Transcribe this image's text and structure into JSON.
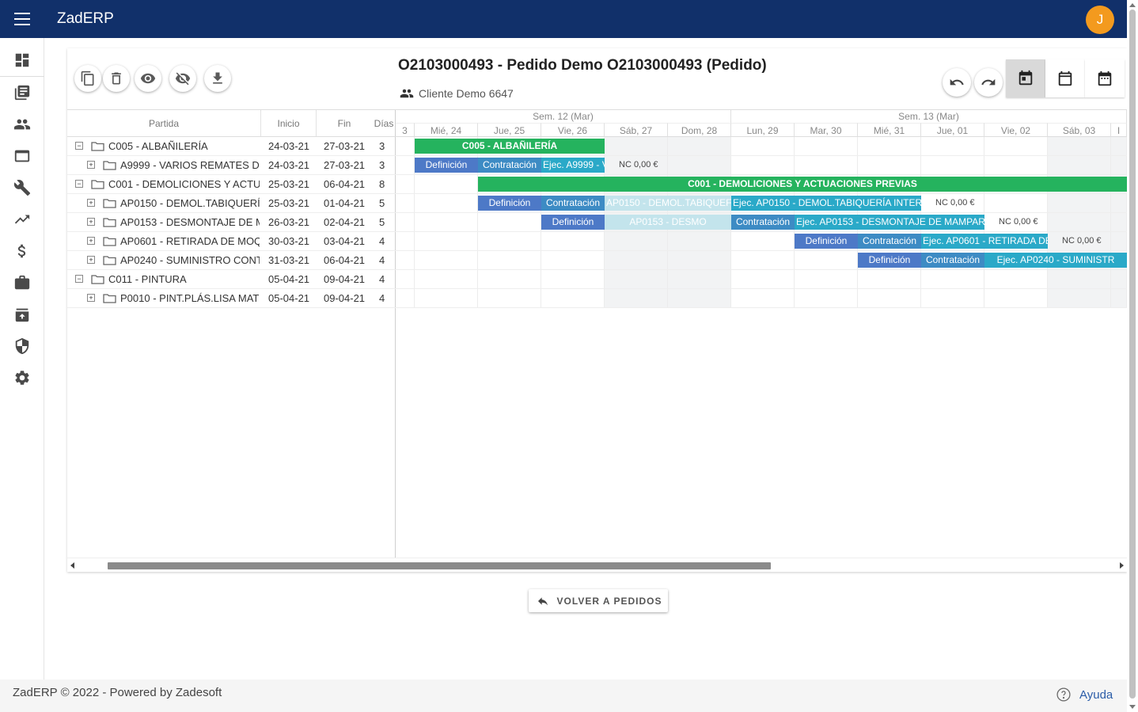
{
  "app": {
    "title": "ZadERP",
    "avatar_letter": "J"
  },
  "sidebar": {
    "items": [
      "dashboard-icon",
      "library-icon",
      "people-icon",
      "browser-icon",
      "wrench-icon",
      "trending-icon",
      "dollar-icon",
      "briefcase-icon",
      "archive-icon",
      "shield-icon",
      "gear-icon"
    ]
  },
  "document": {
    "title": "O2103000493 - Pedido Demo O2103000493 (Pedido)",
    "client": "Cliente Demo 6647"
  },
  "table": {
    "headers": {
      "partida": "Partida",
      "inicio": "Inicio",
      "fin": "Fin",
      "dias": "Días"
    },
    "rows": [
      {
        "level": 0,
        "exp": "−",
        "name": "C005 - ALBAÑILERÍA",
        "inicio": "24-03-21",
        "fin": "27-03-21",
        "dias": "3"
      },
      {
        "level": 1,
        "exp": "+",
        "name": "A9999 - VARIOS REMATES DI",
        "inicio": "24-03-21",
        "fin": "27-03-21",
        "dias": "3"
      },
      {
        "level": 0,
        "exp": "−",
        "name": "C001 - DEMOLICIONES Y ACTU",
        "inicio": "25-03-21",
        "fin": "06-04-21",
        "dias": "8"
      },
      {
        "level": 1,
        "exp": "+",
        "name": "AP0150 - DEMOL.TABIQUERÍ.",
        "inicio": "25-03-21",
        "fin": "01-04-21",
        "dias": "5"
      },
      {
        "level": 1,
        "exp": "+",
        "name": "AP0153 - DESMONTAJE DE M",
        "inicio": "26-03-21",
        "fin": "02-04-21",
        "dias": "5"
      },
      {
        "level": 1,
        "exp": "+",
        "name": "AP0601 - RETIRADA DE MOQ",
        "inicio": "30-03-21",
        "fin": "03-04-21",
        "dias": "4"
      },
      {
        "level": 1,
        "exp": "+",
        "name": "AP0240 - SUMINISTRO CONT",
        "inicio": "31-03-21",
        "fin": "06-04-21",
        "dias": "4"
      },
      {
        "level": 0,
        "exp": "−",
        "name": "C011 - PINTURA",
        "inicio": "05-04-21",
        "fin": "09-04-21",
        "dias": "4"
      },
      {
        "level": 1,
        "exp": "+",
        "name": "P0010 - PINT.PLÁS.LISA MATI",
        "inicio": "05-04-21",
        "fin": "09-04-21",
        "dias": "4"
      }
    ]
  },
  "gantt": {
    "weeks": [
      {
        "label": "Sem. 12 (Mar)"
      },
      {
        "label": "Sem. 13 (Mar)"
      }
    ],
    "days": [
      {
        "label": "3",
        "weekend": false
      },
      {
        "label": "Mié, 24",
        "weekend": false
      },
      {
        "label": "Jue, 25",
        "weekend": false
      },
      {
        "label": "Vie, 26",
        "weekend": false
      },
      {
        "label": "Sáb, 27",
        "weekend": true
      },
      {
        "label": "Dom, 28",
        "weekend": true
      },
      {
        "label": "Lun, 29",
        "weekend": false
      },
      {
        "label": "Mar, 30",
        "weekend": false
      },
      {
        "label": "Mié, 31",
        "weekend": false
      },
      {
        "label": "Jue, 01",
        "weekend": false
      },
      {
        "label": "Vie, 02",
        "weekend": false
      },
      {
        "label": "Sáb, 03",
        "weekend": true
      },
      {
        "label": "I",
        "weekend": true
      }
    ],
    "bars": [
      {
        "row": 0,
        "start": 0,
        "span": 3,
        "kind": "green",
        "label": "C005 - ALBAÑILERÍA"
      },
      {
        "row": 1,
        "start": 0,
        "span": 1,
        "kind": "def",
        "label": "Definición"
      },
      {
        "row": 1,
        "start": 1,
        "span": 1,
        "kind": "con",
        "label": "Contratación"
      },
      {
        "row": 1,
        "start": 2,
        "span": 1,
        "kind": "eje",
        "label": "Ejec. A9999 - V"
      },
      {
        "row": 2,
        "start": 1,
        "span": 11,
        "kind": "green",
        "label": "C001 - DEMOLICIONES Y ACTUACIONES PREVIAS"
      },
      {
        "row": 3,
        "start": 1,
        "span": 1,
        "kind": "def",
        "label": "Definición"
      },
      {
        "row": 3,
        "start": 2,
        "span": 1,
        "kind": "con",
        "label": "Contratación"
      },
      {
        "row": 3,
        "start": 3,
        "span": 2,
        "kind": "ghost",
        "label": "AP0150 - DEMOL.TABIQUEF"
      },
      {
        "row": 3,
        "start": 5,
        "span": 3,
        "kind": "eje",
        "label": "Ejec. AP0150 - DEMOL.TABIQUERÍA INTER"
      },
      {
        "row": 4,
        "start": 2,
        "span": 1,
        "kind": "def",
        "label": "Definición"
      },
      {
        "row": 4,
        "start": 3,
        "span": 2,
        "kind": "ghost",
        "label": "AP0153 - DESMO"
      },
      {
        "row": 4,
        "start": 5,
        "span": 1,
        "kind": "con",
        "label": "Contratación"
      },
      {
        "row": 4,
        "start": 6,
        "span": 3,
        "kind": "eje",
        "label": "Ejec. AP0153 - DESMONTAJE DE MAMPAR"
      },
      {
        "row": 5,
        "start": 6,
        "span": 1,
        "kind": "def",
        "label": "Definición"
      },
      {
        "row": 5,
        "start": 7,
        "span": 1,
        "kind": "con",
        "label": "Contratación"
      },
      {
        "row": 5,
        "start": 8,
        "span": 2,
        "kind": "eje",
        "label": "Ejec. AP0601 - RETIRADA DE"
      },
      {
        "row": 6,
        "start": 7,
        "span": 1,
        "kind": "def",
        "label": "Definición"
      },
      {
        "row": 6,
        "start": 8,
        "span": 1,
        "kind": "con",
        "label": "Contratación"
      },
      {
        "row": 6,
        "start": 9,
        "span": 3,
        "kind": "eje",
        "label": "Ejec. AP0240 - SUMINISTR"
      }
    ],
    "nc_labels": [
      {
        "row": 1,
        "col": 3,
        "label": "NC 0,00 €"
      },
      {
        "row": 3,
        "col": 8,
        "label": "NC 0,00 €"
      },
      {
        "row": 4,
        "col": 9,
        "label": "NC 0,00 €"
      },
      {
        "row": 5,
        "col": 10,
        "label": "NC 0,00 €"
      }
    ]
  },
  "actions": {
    "back_label": "VOLVER A PEDIDOS"
  },
  "footer": {
    "text": "ZadERP © 2022 - Powered by Zadesoft",
    "help_label": "Ayuda"
  }
}
